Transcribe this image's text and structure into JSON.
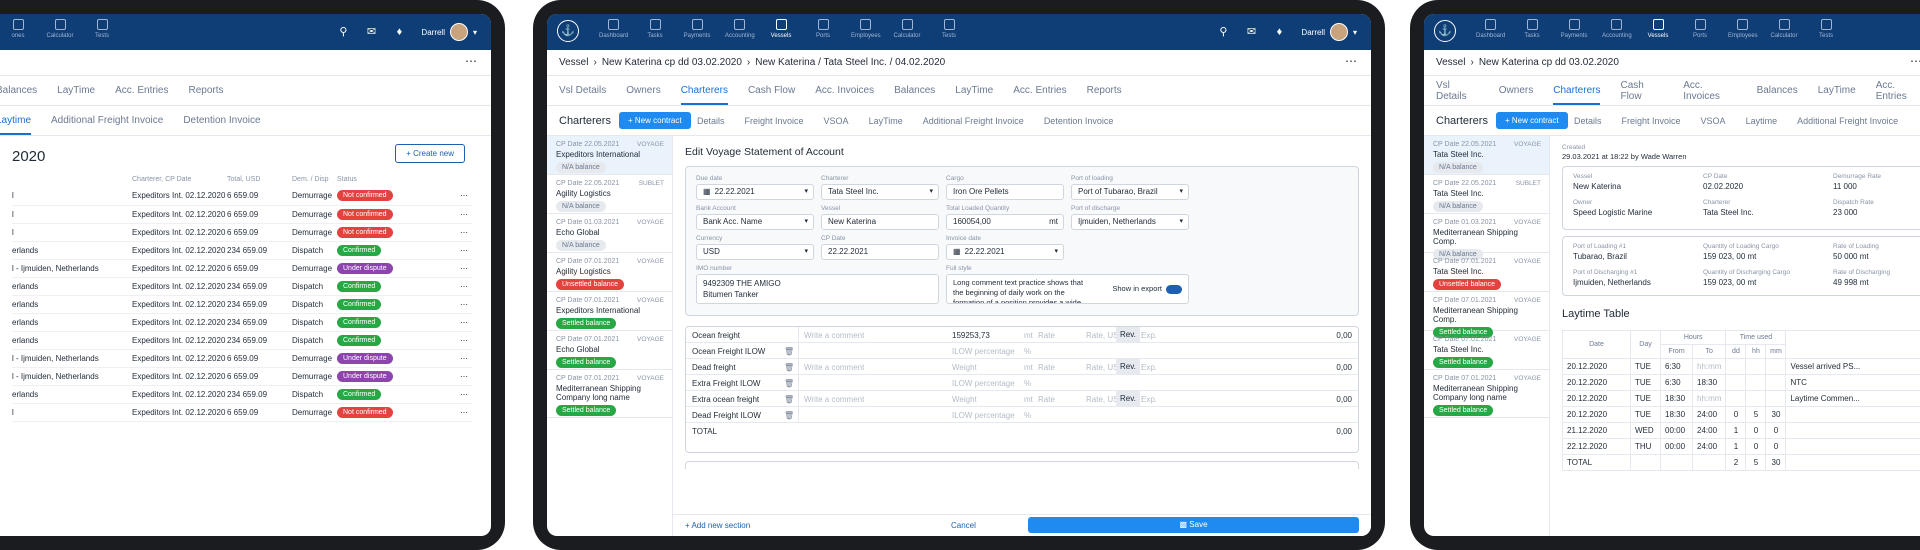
{
  "nav": {
    "items": [
      "Dashboard",
      "Tasks",
      "Payments",
      "Accounting",
      "Vessels",
      "Ports",
      "Employees",
      "Calculator",
      "Tests"
    ],
    "user": "Darrell"
  },
  "panelA": {
    "nav_items": [
      "ones",
      "Calculator",
      "Tests"
    ],
    "tabs": [
      "Balances",
      "LayTime",
      "Acc. Entries",
      "Reports"
    ],
    "subtabs": [
      "Laytime",
      "Additional Freight Invoice",
      "Detention Invoice"
    ],
    "year": "2020",
    "create_label": "Create new",
    "headers": [
      "Charterer, CP Date",
      "Total, USD",
      "Dem. / Disp",
      "Status"
    ],
    "rows": [
      [
        "l",
        "Expeditors Int. 02.12.2020",
        "6 659.09",
        "Demurrage",
        "Not confirmed"
      ],
      [
        "l",
        "Expeditors Int. 02.12.2020",
        "6 659.09",
        "Demurrage",
        "Not confirmed"
      ],
      [
        "l",
        "Expeditors Int. 02.12.2020",
        "6 659.09",
        "Demurrage",
        "Not confirmed"
      ],
      [
        "erlands",
        "Expeditors Int. 02.12.2020",
        "234 659.09",
        "Dispatch",
        "Confirmed"
      ],
      [
        "l - Ijmuiden, Netherlands",
        "Expeditors Int. 02.12.2020",
        "6 659.09",
        "Demurrage",
        "Under dispute"
      ],
      [
        "erlands",
        "Expeditors Int. 02.12.2020",
        "234 659.09",
        "Dispatch",
        "Confirmed"
      ],
      [
        "erlands",
        "Expeditors Int. 02.12.2020",
        "234 659.09",
        "Dispatch",
        "Confirmed"
      ],
      [
        "erlands",
        "Expeditors Int. 02.12.2020",
        "234 659.09",
        "Dispatch",
        "Confirmed"
      ],
      [
        "erlands",
        "Expeditors Int. 02.12.2020",
        "234 659.09",
        "Dispatch",
        "Confirmed"
      ],
      [
        "l - Ijmuiden, Netherlands",
        "Expeditors Int. 02.12.2020",
        "6 659.09",
        "Demurrage",
        "Under dispute"
      ],
      [
        "l - Ijmuiden, Netherlands",
        "Expeditors Int. 02.12.2020",
        "6 659.09",
        "Demurrage",
        "Under dispute"
      ],
      [
        "erlands",
        "Expeditors Int. 02.12.2020",
        "234 659.09",
        "Dispatch",
        "Confirmed"
      ],
      [
        "l",
        "Expeditors Int. 02.12.2020",
        "6 659.09",
        "Demurrage",
        "Not confirmed"
      ]
    ]
  },
  "panelB": {
    "breadcrumb": [
      "Vessel",
      "New Katerina cp dd 03.02.2020",
      "New Katerina / Tata Steel Inc. / 04.02.2020"
    ],
    "tabs": [
      "Vsl Details",
      "Owners",
      "Charterers",
      "Cash Flow",
      "Acc. Invoices",
      "Balances",
      "LayTime",
      "Acc. Entries",
      "Reports"
    ],
    "active_tab": "Charterers",
    "charterers_title": "Charterers",
    "new_contract": "New contract",
    "subtabs": [
      "Details",
      "Freight Invoice",
      "VSOA",
      "LayTime",
      "Additional Freight Invoice",
      "Detention Invoice"
    ],
    "list": [
      {
        "date": "CP Date 22.05.2021",
        "type": "VOYAGE",
        "name": "Expeditors International",
        "badge": "N/A balance",
        "color": "grey"
      },
      {
        "date": "CP Date 22.05.2021",
        "type": "SUBLET",
        "name": "Agility Logistics",
        "badge": "N/A balance",
        "color": "grey"
      },
      {
        "date": "CP Date 01.03.2021",
        "type": "VOYAGE",
        "name": "Echo Global",
        "badge": "N/A balance",
        "color": "grey"
      },
      {
        "date": "CP Date 07.01.2021",
        "type": "VOYAGE",
        "name": "Agility Logistics",
        "badge": "Unsettled balance",
        "color": "red"
      },
      {
        "date": "CP Date 07.01.2021",
        "type": "VOYAGE",
        "name": "Expeditors International",
        "badge": "Settled balance",
        "color": "green"
      },
      {
        "date": "CP Date 07.01.2021",
        "type": "VOYAGE",
        "name": "Echo Global",
        "badge": "Settled balance",
        "color": "green"
      },
      {
        "date": "CP Date 07.01.2021",
        "type": "VOYAGE",
        "name": "Mediterranean Shipping Company long name",
        "badge": "Settled balance",
        "color": "green"
      }
    ],
    "form_title": "Edit Voyage Statement of Account",
    "fields": {
      "due_date_label": "Due date",
      "due_date": "22.22.2021",
      "charterer_label": "Charterer",
      "charterer": "Tata Steel Inc.",
      "cargo_label": "Cargo",
      "cargo": "Iron Ore Pellets",
      "pol_label": "Port of loading",
      "pol": "Port of Tubarao, Brazil",
      "bank_label": "Bank Account",
      "bank": "Bank Acc. Name",
      "vessel_label": "Vessel",
      "vessel": "New Katerina",
      "qty_label": "Total Loaded Quantity",
      "qty": "160054,00",
      "qty_unit": "mt",
      "pod_label": "Port of discharge",
      "pod": "Ijmuiden, Netherlands",
      "currency_label": "Currency",
      "currency": "USD",
      "cp_label": "CP Date",
      "cp": "22.22.2021",
      "inv_label": "Invoice date",
      "inv": "22.22.2021",
      "imo_label": "IMO number",
      "imo1": "9492309 THE AMIGO",
      "imo2": "Bitumen Tanker",
      "style_label": "Full style",
      "style_text": "Long comment text  practice shows that the beginning of daily work on the formation of a position provides a wide range",
      "show_export": "Show in export"
    },
    "freight": [
      {
        "name": "Ocean freight",
        "c": "Write a comment",
        "v": "159253,73",
        "u": "mt",
        "r": "Rate",
        "ru": "Rate, USD",
        "rev": "Rev.",
        "exp": "Exp.",
        "tot": "0,00",
        "bin": false
      },
      {
        "name": "Ocean Freight ILOW",
        "c": "",
        "v": "ILOW percentage",
        "u": "%",
        "bin": true
      },
      {
        "name": "Dead freight",
        "c": "Write a comment",
        "v": "Weight",
        "u": "mt",
        "r": "Rate",
        "ru": "Rate, USD",
        "rev": "Rev.",
        "exp": "Exp.",
        "tot": "0,00",
        "bin": true
      },
      {
        "name": "Extra Freight ILOW",
        "c": "",
        "v": "ILOW percentage",
        "u": "%",
        "bin": true
      },
      {
        "name": "Extra ocean freight",
        "c": "Write a comment",
        "v": "Weight",
        "u": "mt",
        "r": "Rate",
        "ru": "Rate, USD",
        "rev": "Rev.",
        "exp": "Exp.",
        "tot": "0,00",
        "bin": true
      },
      {
        "name": "Dead Freight ILOW",
        "c": "",
        "v": "ILOW percentage",
        "u": "%",
        "bin": true
      }
    ],
    "total_label": "TOTAL",
    "total": "0,00",
    "add_section": "Add new section",
    "cancel": "Cancel",
    "save": "Save"
  },
  "panelC": {
    "breadcrumb": [
      "Vessel",
      "New Katerina cp dd 03.02.2020"
    ],
    "tabs": [
      "Vsl Details",
      "Owners",
      "Charterers",
      "Cash Flow",
      "Acc. Invoices",
      "Balances",
      "LayTime",
      "Acc. Entries"
    ],
    "active_tab": "Charterers",
    "charterers_title": "Charterers",
    "new_contract": "New contract",
    "subtabs": [
      "Details",
      "Freight Invoice",
      "VSOA",
      "Laytime",
      "Additional Freight Invoice"
    ],
    "list": [
      {
        "date": "CP Date 22.05.2021",
        "type": "VOYAGE",
        "name": "Tata Steel Inc.",
        "badge": "N/A balance",
        "color": "grey"
      },
      {
        "date": "CP Date 22.05.2021",
        "type": "SUBLET",
        "name": "Tata Steel Inc.",
        "badge": "N/A balance",
        "color": "grey"
      },
      {
        "date": "CP Date 01.03.2021",
        "type": "VOYAGE",
        "name": "Mediterranean Shipping Comp.",
        "badge": "N/A balance",
        "color": "grey"
      },
      {
        "date": "CP Date 07.01.2021",
        "type": "VOYAGE",
        "name": "Tata Steel Inc.",
        "badge": "Unsettled balance",
        "color": "red"
      },
      {
        "date": "CP Date 07.01.2021",
        "type": "VOYAGE",
        "name": "Mediterranean Shipping Comp.",
        "badge": "Settled balance",
        "color": "green"
      },
      {
        "date": "CP Date 07.01.2021",
        "type": "VOYAGE",
        "name": "Tata Steel Inc.",
        "badge": "Settled balance",
        "color": "green"
      },
      {
        "date": "CP Date 07.01.2021",
        "type": "VOYAGE",
        "name": "Mediterranean Shipping Company long name",
        "badge": "Settled balance",
        "color": "green"
      }
    ],
    "created_label": "Created",
    "created": "29.03.2021 at 18:22 by Wade Warren",
    "info1": [
      {
        "l": "Vessel",
        "v": "New Katerina"
      },
      {
        "l": "CP Date",
        "v": "02.02.2020"
      },
      {
        "l": "Demurrage Rate",
        "v": "11 000"
      },
      {
        "l": "Owner",
        "v": "Speed Logistic Marine"
      },
      {
        "l": "Charterer",
        "v": "Tata Steel Inc."
      },
      {
        "l": "Dispatch Rate",
        "v": "23 000"
      }
    ],
    "info2": [
      {
        "l": "Port of Loading #1",
        "v": "Tubarao, Brazil"
      },
      {
        "l": "Quantity of Loading Cargo",
        "v": "159 023, 00 mt"
      },
      {
        "l": "Rate of Loading",
        "v": "50 000 mt"
      },
      {
        "l": "Port of Discharging #1",
        "v": "Ijmuiden, Netherlands"
      },
      {
        "l": "Quantity of Discharging Cargo",
        "v": "159 023, 00 mt"
      },
      {
        "l": "Rate of Discharging",
        "v": "49 998 mt"
      }
    ],
    "laytime_title": "Laytime Table",
    "headers": {
      "date": "Date",
      "day": "Day",
      "hours": "Hours",
      "from": "From",
      "to": "To",
      "used": "Time used",
      "dd": "dd",
      "hh": "hh",
      "mm": "mm"
    },
    "rows": [
      [
        "20.12.2020",
        "TUE",
        "6:30",
        "hh:mm",
        "",
        "",
        "",
        "Vessel arrived PS..."
      ],
      [
        "20.12.2020",
        "TUE",
        "6:30",
        "18:30",
        "",
        "",
        "",
        "NTC"
      ],
      [
        "20.12.2020",
        "TUE",
        "18:30",
        "hh:mm",
        "",
        "",
        "",
        "Laytime Commen..."
      ],
      [
        "20.12.2020",
        "TUE",
        "18:30",
        "24:00",
        "0",
        "5",
        "30",
        ""
      ],
      [
        "21.12.2020",
        "WED",
        "00:00",
        "24:00",
        "1",
        "0",
        "0",
        ""
      ],
      [
        "22.12.2020",
        "THU",
        "00:00",
        "24:00",
        "1",
        "0",
        "0",
        ""
      ]
    ],
    "total_label": "TOTAL",
    "total": [
      "2",
      "5",
      "30"
    ]
  }
}
